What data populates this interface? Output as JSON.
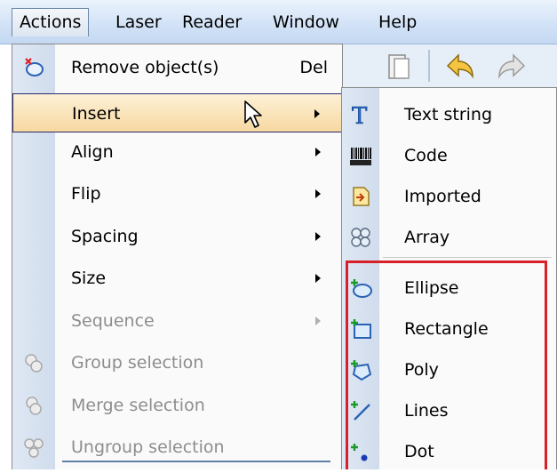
{
  "menubar": {
    "items": [
      {
        "label": "Actions"
      },
      {
        "label": "Laser"
      },
      {
        "label": "Reader"
      },
      {
        "label": "Window"
      },
      {
        "label": "Help"
      }
    ]
  },
  "actions_menu": {
    "items": [
      {
        "label": "Remove object(s)",
        "shortcut": "Del",
        "icon": "remove-object-icon"
      },
      {
        "label": "Insert",
        "state": "highlighted"
      },
      {
        "label": "Align"
      },
      {
        "label": "Flip"
      },
      {
        "label": "Spacing"
      },
      {
        "label": "Size"
      },
      {
        "label": "Sequence",
        "state": "disabled"
      },
      {
        "label": "Group selection",
        "state": "disabled",
        "icon": "group-icon"
      },
      {
        "label": "Merge selection",
        "state": "disabled",
        "icon": "merge-icon"
      },
      {
        "label": "Ungroup selection",
        "state": "disabled",
        "icon": "ungroup-icon"
      }
    ]
  },
  "insert_submenu": {
    "items": [
      {
        "label": "Text string",
        "icon": "text-string-icon"
      },
      {
        "label": "Code",
        "icon": "barcode-icon"
      },
      {
        "label": "Imported",
        "icon": "imported-icon"
      },
      {
        "label": "Array",
        "icon": "array-icon"
      },
      {
        "label": "Ellipse",
        "icon": "ellipse-icon"
      },
      {
        "label": "Rectangle",
        "icon": "rectangle-icon"
      },
      {
        "label": "Poly",
        "icon": "poly-icon"
      },
      {
        "label": "Lines",
        "icon": "lines-icon"
      },
      {
        "label": "Dot",
        "icon": "dot-icon"
      }
    ]
  },
  "colors": {
    "highlight_border": "#d8202a",
    "menu_hover": "#f7d8a0",
    "disabled_text": "#8d8d8d"
  }
}
